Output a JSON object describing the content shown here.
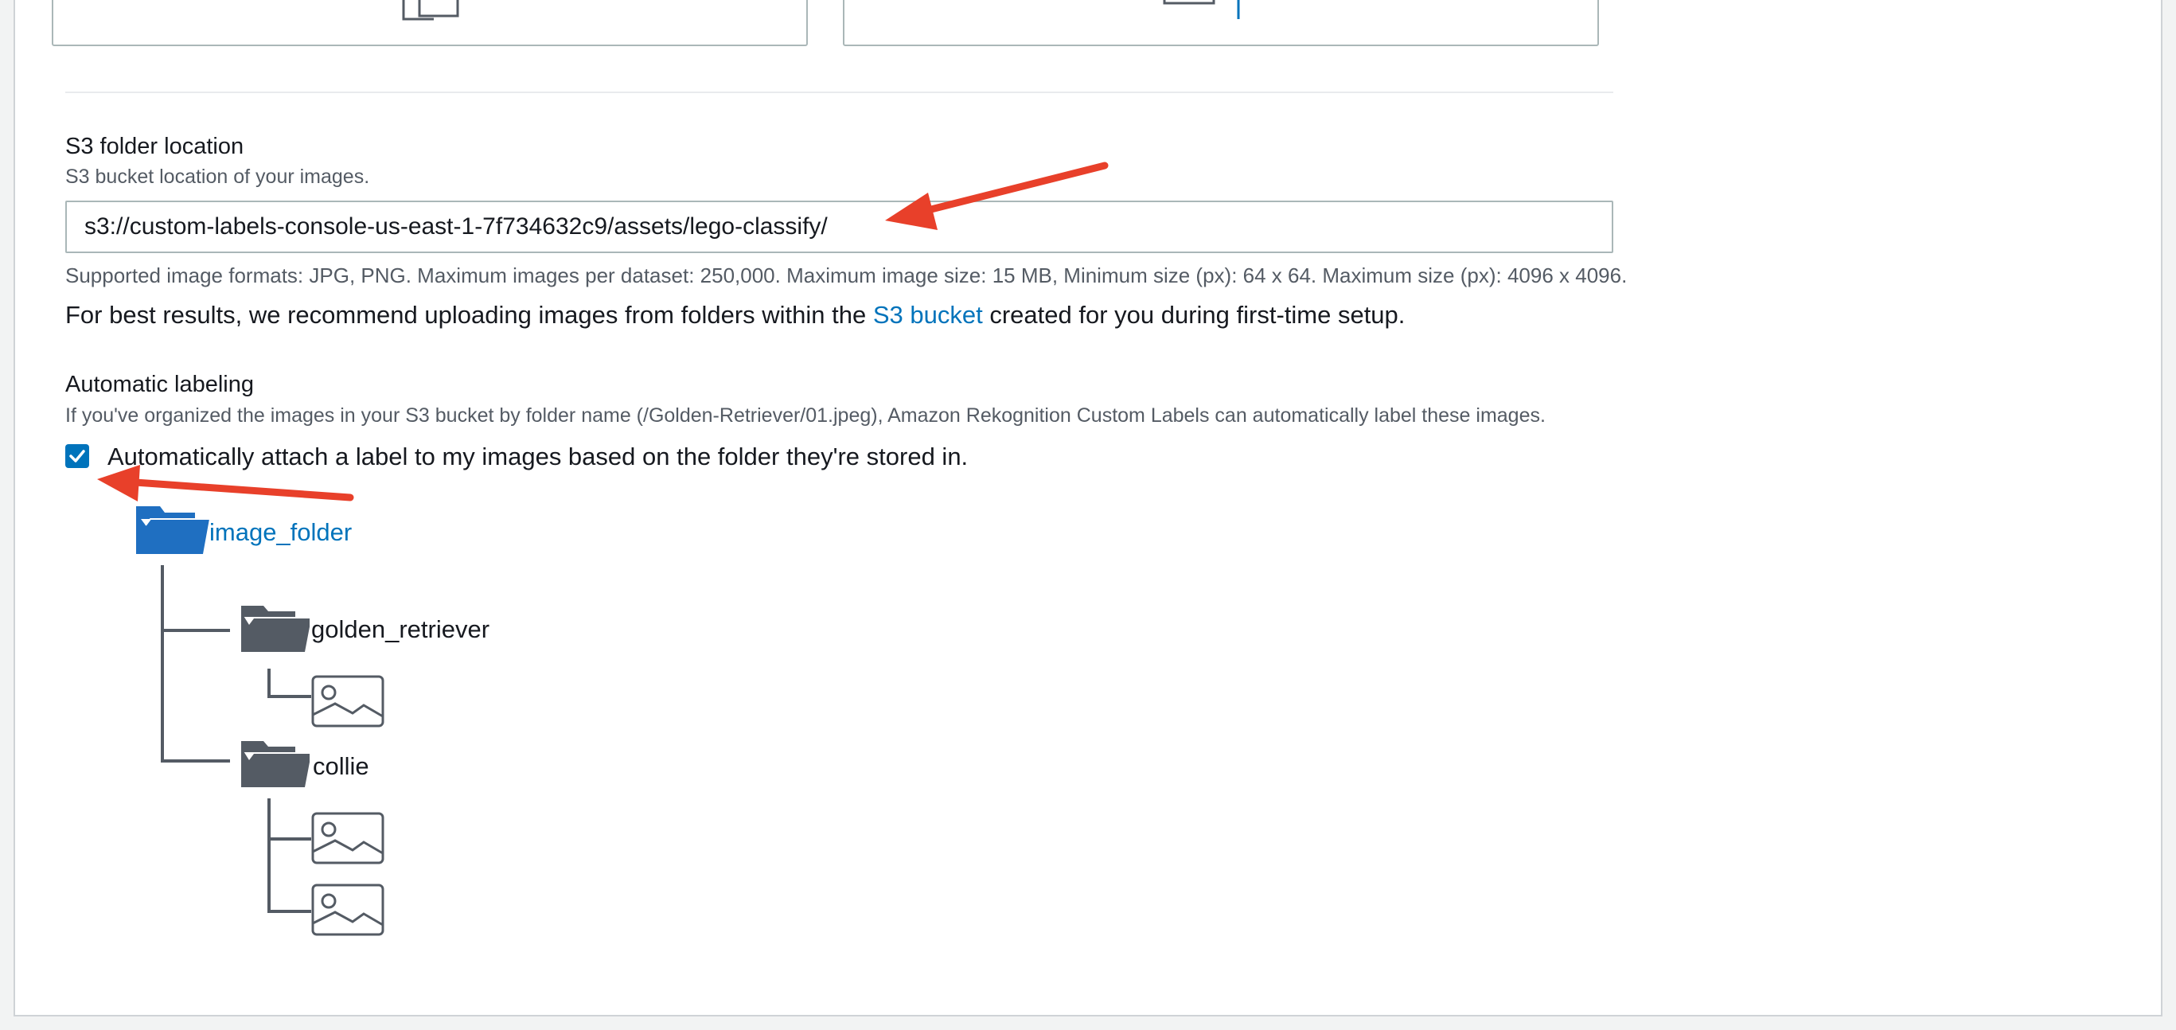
{
  "s3_folder": {
    "label": "S3 folder location",
    "description": "S3 bucket location of your images.",
    "value": "s3://custom-labels-console-us-east-1-7f734632c9/assets/lego-classify/",
    "formats_note": "Supported image formats: JPG, PNG. Maximum images per dataset: 250,000. Maximum image size: 15 MB, Minimum size (px): 64 x 64. Maximum size (px): 4096 x 4096.",
    "recommendation_prefix": "For best results, we recommend uploading images from folders within the ",
    "recommendation_link": "S3 bucket",
    "recommendation_suffix": " created for you during first-time setup."
  },
  "automatic_labeling": {
    "label": "Automatic labeling",
    "description": "If you've organized the images in your S3 bucket by folder name (/Golden-Retriever/01.jpeg), Amazon Rekognition Custom Labels can automatically label these images.",
    "checkbox_label": "Automatically attach a label to my images based on the folder they're stored in.",
    "checked": true
  },
  "folder_tree": {
    "root": "image_folder",
    "folders": [
      {
        "name": "golden_retriever",
        "image_count": 1
      },
      {
        "name": "collie",
        "image_count": 2
      }
    ]
  },
  "colors": {
    "accent": "#0073bb",
    "annotation_arrow": "#e8402a",
    "folder_dark": "#545b64",
    "folder_root": "#1f6fc1"
  },
  "icons": [
    "checkmark-icon",
    "folder-icon",
    "image-icon",
    "arrow-annotation"
  ]
}
